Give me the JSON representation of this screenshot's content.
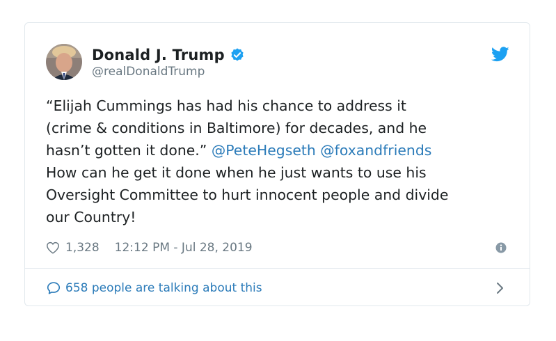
{
  "author": {
    "display_name": "Donald J. Trump",
    "handle": "@realDonaldTrump",
    "verified": true
  },
  "tweet": {
    "line1": "“Elijah Cummings has had his chance to address it",
    "line2": "(crime & conditions in Baltimore) for decades, and he",
    "line3_text": "hasn’t gotten it done.” ",
    "mention1": "@PeteHegseth",
    "mention_space": " ",
    "mention2": "@foxandfriends",
    "line4": "How can he get it done when he just wants to use his",
    "line5": "Oversight Committee to hurt innocent people and divide",
    "line6": "our Country!"
  },
  "meta": {
    "like_count": "1,328",
    "timestamp": "12:12 PM - Jul 28, 2019"
  },
  "footer": {
    "talking_label": "658 people are talking about this"
  },
  "icons": {
    "verified": "verified-badge-icon",
    "bird": "twitter-bird-icon",
    "heart": "heart-icon",
    "info": "info-icon",
    "bubble": "chat-bubble-icon",
    "chevron": "chevron-right-icon"
  },
  "colors": {
    "link": "#2b7bb9",
    "twitter_blue": "#1da1f2",
    "muted": "#697882",
    "border": "#e1e8ed"
  }
}
